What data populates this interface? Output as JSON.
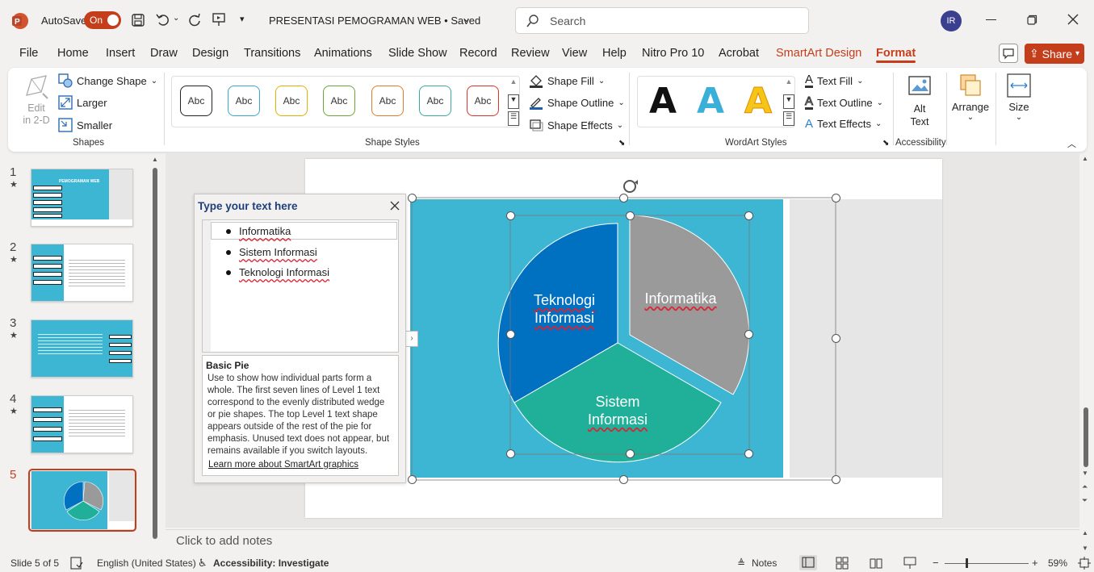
{
  "titlebar": {
    "autosave_label": "AutoSave",
    "autosave_state": "On",
    "doc_title": "PRESENTASI PEMOGRAMAN WEB • Saved",
    "search_placeholder": "Search",
    "avatar_initials": "IR"
  },
  "menu": {
    "tabs": [
      "File",
      "Home",
      "Insert",
      "Draw",
      "Design",
      "Transitions",
      "Animations",
      "Slide Show",
      "Record",
      "Review",
      "View",
      "Help",
      "Nitro Pro 10",
      "Acrobat",
      "SmartArt Design",
      "Format"
    ],
    "share_label": "Share"
  },
  "ribbon": {
    "shapes": {
      "edit_line1": "Edit",
      "edit_line2": "in 2-D",
      "change_shape": "Change Shape",
      "larger": "Larger",
      "smaller": "Smaller",
      "group_label": "Shapes"
    },
    "shape_styles": {
      "swatch_text": "Abc",
      "swatch_colors": [
        "#222222",
        "#3aa6c9",
        "#e0b000",
        "#6ea33a",
        "#e07b2e",
        "#3fa89c",
        "#d9342b"
      ],
      "shape_fill": "Shape Fill",
      "shape_outline": "Shape Outline",
      "shape_effects": "Shape Effects",
      "group_label": "Shape Styles"
    },
    "wordart": {
      "letter": "A",
      "text_fill": "Text Fill",
      "text_outline": "Text Outline",
      "text_effects": "Text Effects",
      "group_label": "WordArt Styles"
    },
    "accessibility": {
      "alt_line1": "Alt",
      "alt_line2": "Text",
      "group_label": "Accessibility"
    },
    "arrange_label": "Arrange",
    "size_label": "Size"
  },
  "slides_panel": {
    "numbers": [
      "1",
      "2",
      "3",
      "4",
      "5"
    ],
    "thumb1_title": "PEMOGRAMAN WEB",
    "thumb5_labels": [
      "Teknologi Informasi",
      "Informatika",
      "Sistem Informasi"
    ]
  },
  "text_pane": {
    "title": "Type your text here",
    "items": [
      "Informatika",
      "Sistem Informasi",
      "Teknologi Informasi"
    ],
    "desc_title": "Basic Pie",
    "desc_body": "Use to show how individual parts form a whole. The first seven lines of Level 1 text correspond to the evenly distributed wedge or pie shapes. The top Level 1 text shape appears outside of the rest of the pie for emphasis. Unused text does not appear, but remains available if you switch layouts.",
    "learn_more": "Learn more about SmartArt graphics"
  },
  "smartart": {
    "slice_tekinfo_line1": "Teknologi",
    "slice_tekinfo_line2": "Informasi",
    "slice_informatika": "Informatika",
    "slice_sisinfo_line1": "Sistem",
    "slice_sisinfo_line2": "Informasi",
    "colors": {
      "tekinfo": "#0070c0",
      "informatika": "#9a9a9a",
      "sisinfo": "#20b09a",
      "background": "#3db6d3"
    }
  },
  "notes_placeholder": "Click to add notes",
  "statusbar": {
    "slide_info": "Slide 5 of 5",
    "language": "English (United States)",
    "accessibility": "Accessibility: Investigate",
    "notes": "Notes",
    "zoom": "59%"
  }
}
